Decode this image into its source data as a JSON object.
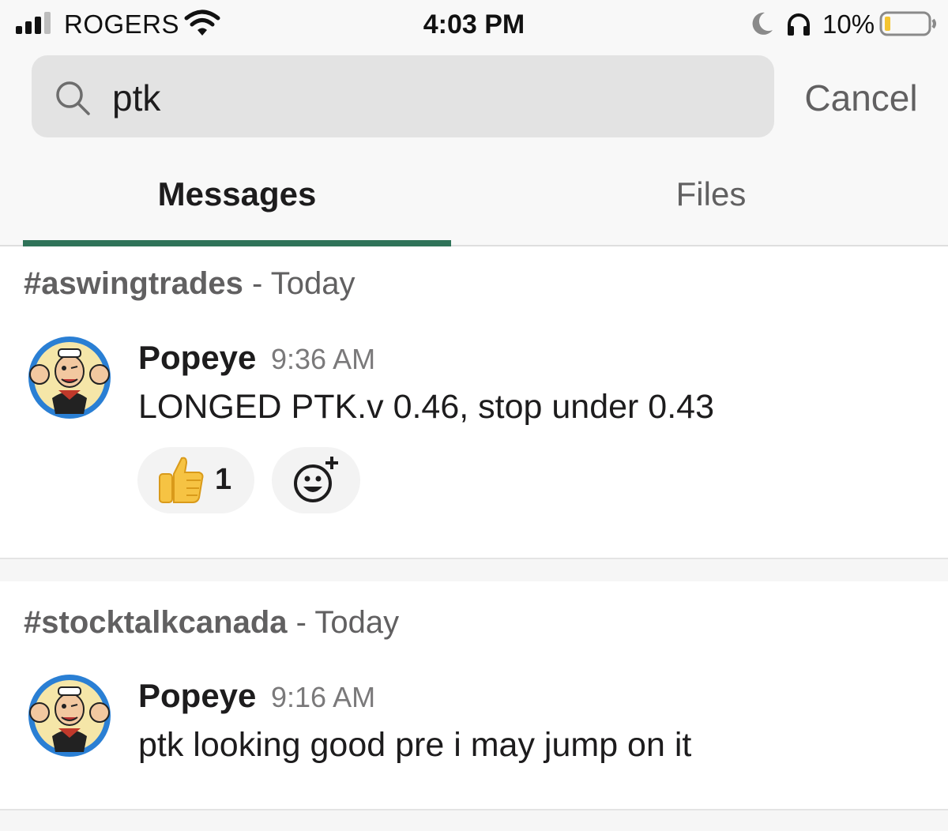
{
  "status_bar": {
    "carrier": "ROGERS",
    "time": "4:03 PM",
    "battery_percent": "10%",
    "signal_bars": 3,
    "icons": [
      "signal-icon",
      "wifi-icon",
      "moon-icon",
      "headphones-icon",
      "battery-icon"
    ]
  },
  "search": {
    "query": "ptk",
    "cancel_label": "Cancel"
  },
  "tabs": [
    {
      "label": "Messages",
      "active": true
    },
    {
      "label": "Files",
      "active": false
    }
  ],
  "colors": {
    "tab_accent": "#2f7359",
    "muted_text": "#616061",
    "primary_text": "#1d1c1d"
  },
  "results": [
    {
      "channel": "#aswingtrades",
      "date_suffix": " - Today",
      "author": "Popeye",
      "time": "9:36 AM",
      "text": "LONGED PTK.v 0.46, stop under 0.43",
      "reactions": [
        {
          "emoji": "thumbs-up",
          "count": "1"
        }
      ]
    },
    {
      "channel": "#stocktalkcanada",
      "date_suffix": " - Today",
      "author": "Popeye",
      "time": "9:16 AM",
      "text": "ptk looking good pre i may jump on it",
      "reactions": []
    }
  ]
}
